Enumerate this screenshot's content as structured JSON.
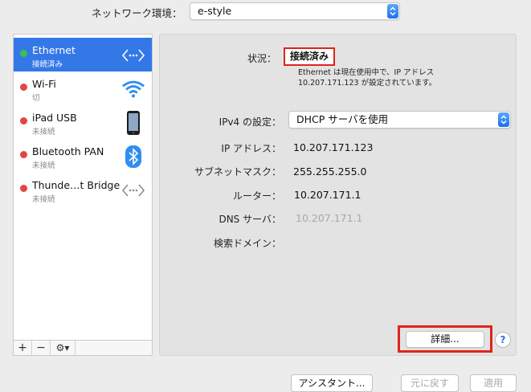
{
  "location": {
    "label": "ネットワーク環境：",
    "value": "e-style"
  },
  "services": [
    {
      "name": "Ethernet",
      "status": "接続済み",
      "dot": "green",
      "icon": "ethernet-icon",
      "selected": true
    },
    {
      "name": "Wi-Fi",
      "status": "切",
      "dot": "red",
      "icon": "wifi-icon",
      "selected": false
    },
    {
      "name": "iPad USB",
      "status": "未接続",
      "dot": "red",
      "icon": "ipad-icon",
      "selected": false
    },
    {
      "name": "Bluetooth PAN",
      "status": "未接続",
      "dot": "red",
      "icon": "bluetooth-icon",
      "selected": false
    },
    {
      "name": "Thunde…t Bridge",
      "status": "未接続",
      "dot": "red",
      "icon": "ethernet-icon",
      "selected": false
    }
  ],
  "sidebar_tools": {
    "add": "+",
    "remove": "−",
    "gear": "⚙▾"
  },
  "detail": {
    "status_label": "状況：",
    "status_value": "接続済み",
    "status_desc_1": "Ethernet は現在使用中で、IP アドレス",
    "status_desc_2": "10.207.171.123 が設定されています。",
    "ipv4_label": "IPv4 の設定：",
    "ipv4_value": "DHCP サーバを使用",
    "ip_label": "IP アドレス：",
    "ip_value": "10.207.171.123",
    "subnet_label": "サブネットマスク：",
    "subnet_value": "255.255.255.0",
    "router_label": "ルーター：",
    "router_value": "10.207.171.1",
    "dns_label": "DNS サーバ：",
    "dns_value": "10.207.171.1",
    "search_label": "検索ドメイン：",
    "advanced_button": "詳細...",
    "help_button": "?"
  },
  "bottom": {
    "assistant": "アシスタント...",
    "revert": "元に戻す",
    "apply": "適用"
  },
  "colors": {
    "selection": "#3478e8",
    "highlight": "#e0231b",
    "connected": "#3bc04a",
    "disconnected": "#e5463f"
  }
}
